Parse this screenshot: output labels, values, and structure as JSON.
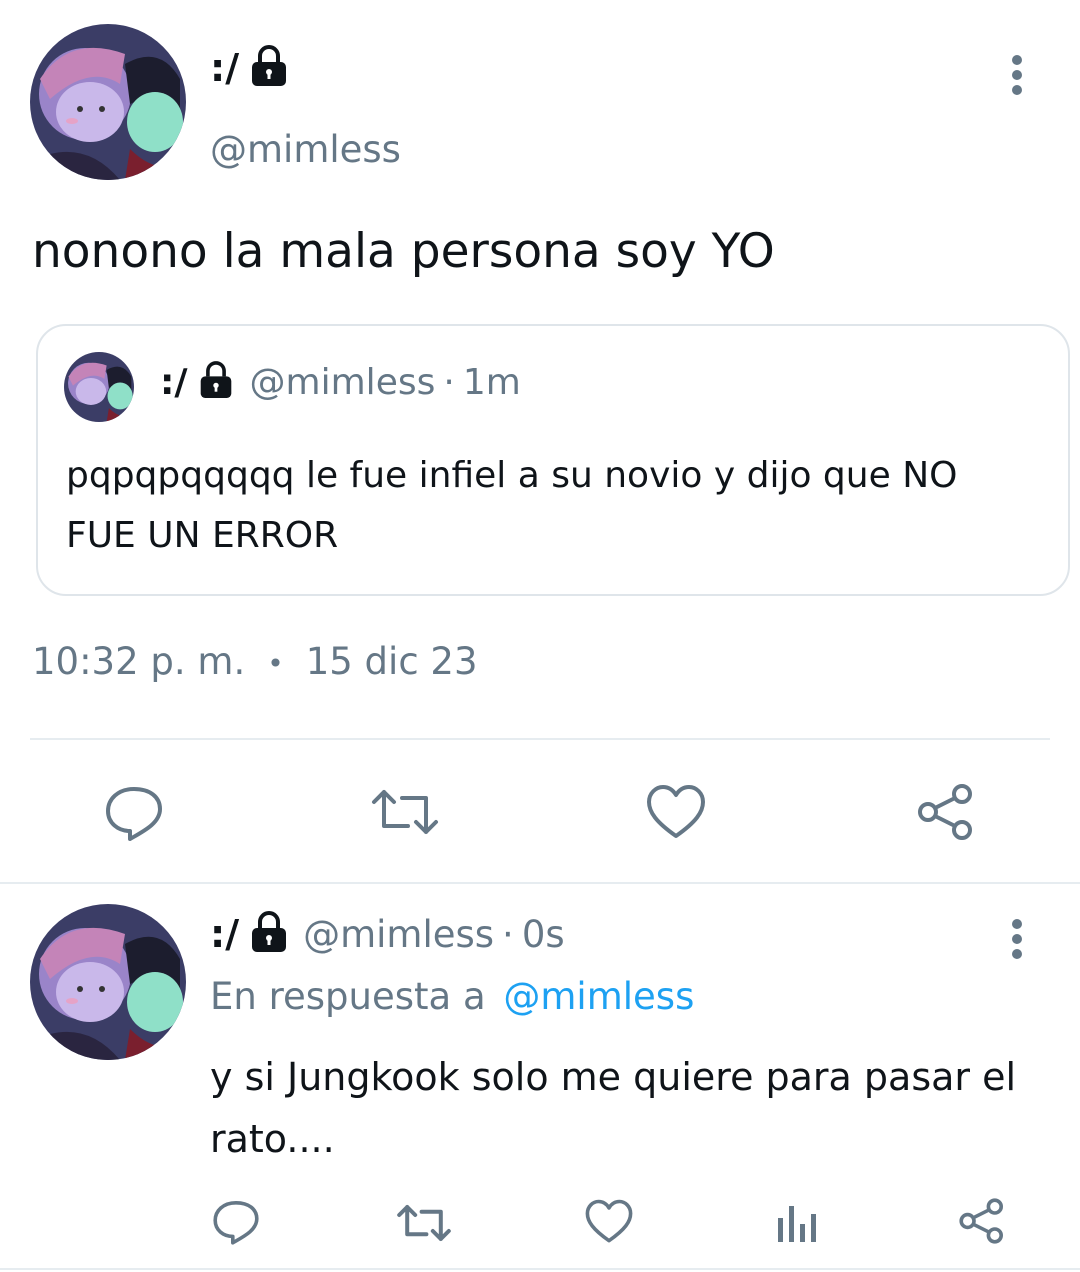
{
  "colors": {
    "text": "#0f1419",
    "secondary": "#657786",
    "link": "#1da1f2",
    "border": "#dfe5ea"
  },
  "main_tweet": {
    "display_name": ":/",
    "handle": "@mimless",
    "text": "nonono la mala persona soy YO",
    "quoted": {
      "display_name": ":/",
      "handle": "@mimless",
      "time": "1m",
      "text_line1": "pqpqpqqqqq le fue infiel a su novio y dijo que NO",
      "text_line2": "FUE UN ERROR"
    },
    "time": "10:32 p. m.",
    "separator": "•",
    "date": "15 dic 23",
    "actions": [
      "reply-icon",
      "retweet-icon",
      "like-icon",
      "share-icon"
    ]
  },
  "reply_tweet": {
    "display_name": ":/",
    "handle": "@mimless",
    "time": "0s",
    "reply_prefix": "En respuesta a",
    "reply_to": "@mimless",
    "text_line1": "y si Jungkook solo me quiere para pasar el",
    "text_line2": "rato....",
    "actions": [
      "reply-icon",
      "retweet-icon",
      "like-icon",
      "analytics-icon",
      "share-icon"
    ]
  },
  "dot_sep": "·"
}
